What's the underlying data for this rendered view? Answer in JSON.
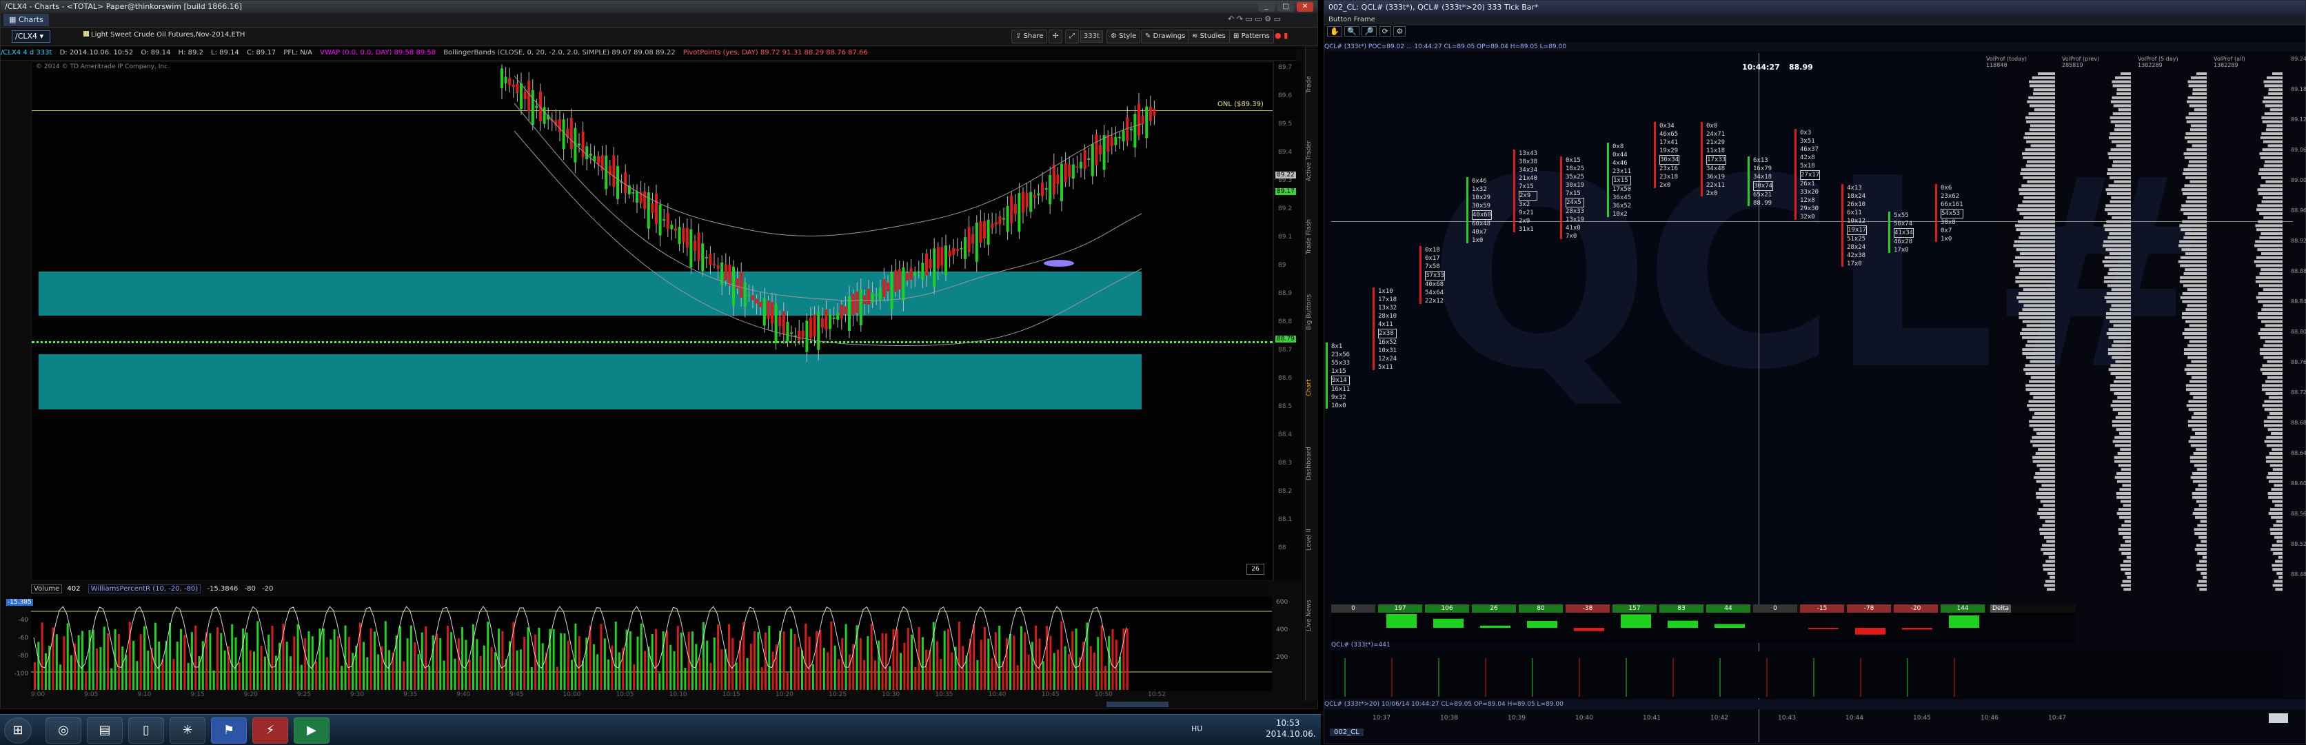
{
  "left_window": {
    "title": "/CLX4 - Charts - <TOTAL> Paper@thinkorswim [build 1866.16]",
    "tab_label": "Charts",
    "symbol": "/CLX4",
    "instrument_name": "Light Sweet Crude Oil Futures,Nov-2014,ETH",
    "toolbar_buttons": [
      "Share",
      "Style",
      "Drawings",
      "Studies",
      "Patterns"
    ],
    "aggregation_badge": "333t",
    "ohlc_stripe": [
      "/CLX4 4 d 333t",
      "D: 2014.10.06. 10:52",
      "O: 89.14",
      "H: 89.2",
      "L: 89.14",
      "C: 89.17",
      "PFL: N/A",
      "VWAP (0.0, 0.0, DAY) 89.58 89.58",
      "BollingerBands (CLOSE, 0, 20, -2.0, 2.0, SIMPLE) 89.07 89.08 89.22",
      "PivotPoints (yes, DAY) 89.72 91.31 88.29 88.76 87.66"
    ],
    "copyright": "© 2014 © TD Ameritrade IP Company, Inc.",
    "onl_label": "ONL ($89.39)",
    "price_ticks": [
      "89.7",
      "89.6",
      "89.5",
      "89.4",
      "89.3",
      "89.2",
      "89.1",
      "89",
      "88.9",
      "88.8",
      "88.7",
      "88.6",
      "88.5",
      "88.4",
      "88.3",
      "88.2",
      "88.1",
      "88"
    ],
    "price_tags": {
      "last": "89.22",
      "bid": "89.17",
      "green": "88.79"
    },
    "corner_badge": "26",
    "indicator": {
      "volume_label": "Volume",
      "volume_value": "402",
      "wr_label": "WilliamsPercentR (10, -20, -80)",
      "wr_value": "-15.3846",
      "wr_hi": "-80",
      "wr_lo": "-20",
      "y_ticks": [
        "-20",
        "-40",
        "-60",
        "-80",
        "-100"
      ],
      "vol_ticks": [
        "600",
        "400",
        "200"
      ],
      "current": "-15.385"
    },
    "time_ticks": [
      "9:00",
      "9:05",
      "9:10",
      "9:15",
      "9:20",
      "9:25",
      "9:30",
      "9:35",
      "9:40",
      "9:45",
      "10:00",
      "10:05",
      "10:10",
      "10:15",
      "10:20",
      "10:25",
      "10:30",
      "10:35",
      "10:40",
      "10:45",
      "10:50",
      "10:52"
    ],
    "side_tabs": [
      "Trade",
      "Active Trader",
      "Trade Flash",
      "Big Buttons",
      "Chart",
      "Dashboard",
      "Level II",
      "Live News"
    ]
  },
  "right_window": {
    "title": "002_CL: QCL# (333t*), QCL# (333t*>20) 333 Tick Bar*",
    "button_frame_label": "Button Frame",
    "info_line": "QCL# (333t*) POC=89.02 ... 10:44:27 CL=89.05 OP=89.04 H=89.05 L=89.00",
    "cursor_time": "10:44:27",
    "cursor_price": "88.99",
    "watermark": "QCL#",
    "footprint_columns": [
      [
        "8x1",
        "23x56",
        "55x33",
        "1x15",
        "9x14",
        "16x11",
        "9x32",
        "10x0"
      ],
      [
        "1x10",
        "17x18",
        "13x32",
        "28x10",
        "4x11",
        "2x38",
        "16x52",
        "10x31",
        "12x24",
        "5x11"
      ],
      [
        "0x18",
        "0x17",
        "7x58",
        "37x33",
        "40x68",
        "54x64",
        "22x12"
      ],
      [
        "0x46",
        "1x32",
        "10x29",
        "30x59",
        "40x60",
        "60x48",
        "40x7",
        "1x0"
      ],
      [
        "13x43",
        "38x38",
        "34x34",
        "21x40",
        "7x15",
        "2x9",
        "3x2",
        "9x21",
        "2x9",
        "31x1"
      ],
      [
        "0x15",
        "18x25",
        "35x25",
        "30x19",
        "7x15",
        "24x5",
        "28x33",
        "13x19",
        "41x0",
        "7x0"
      ],
      [
        "0x8",
        "0x44",
        "4x46",
        "23x11",
        "1x15",
        "17x50",
        "36x45",
        "36x52",
        "10x2"
      ],
      [
        "0x34",
        "46x65",
        "17x41",
        "19x29",
        "30x34",
        "23x16",
        "23x18",
        "2x0"
      ],
      [
        "0x0",
        "24x71",
        "21x29",
        "11x18",
        "17x33",
        "34x48",
        "36x19",
        "22x11",
        "2x0"
      ],
      [
        "6x13",
        "16x79",
        "34x18",
        "30x74",
        "65x21",
        "88.99"
      ],
      [
        "0x3",
        "3x51",
        "46x37",
        "42x8",
        "5x18",
        "27x17",
        "26x1",
        "33x20",
        "12x8",
        "29x30",
        "32x0"
      ],
      [
        "4x13",
        "18x24",
        "26x10",
        "6x11",
        "10x12",
        "19x17",
        "51x25",
        "28x24",
        "42x38",
        "17x0"
      ],
      [
        "5x55",
        "56x74",
        "41x34",
        "46x28",
        "17x0"
      ],
      [
        "0x6",
        "23x62",
        "66x161",
        "54x53",
        "38x8",
        "0x7",
        "1x0"
      ]
    ],
    "volprofile_headers": [
      {
        "label": "VolProf (today)",
        "value": "118848"
      },
      {
        "label": "VolProf (prev)",
        "value": "285819"
      },
      {
        "label": "VolProf (5 day)",
        "value": "1382289"
      },
      {
        "label": "VolProf (all)",
        "value": "1382289"
      }
    ],
    "price_ticks": [
      "89.24",
      "89.18",
      "89.12",
      "89.06",
      "89.00",
      "88.96",
      "88.92",
      "88.88",
      "88.84",
      "88.80",
      "88.76",
      "88.72",
      "88.68",
      "88.64",
      "88.60",
      "88.56",
      "88.52",
      "88.48"
    ],
    "delta_values": [
      "0",
      "197",
      "106",
      "26",
      "80",
      "-38",
      "157",
      "83",
      "44",
      "0",
      "-15",
      "-78",
      "-20",
      "144"
    ],
    "delta_label": "Delta",
    "vol_header": "QCL# (333t*)=441",
    "time_ticks": [
      "10:37",
      "10:38",
      "10:39",
      "10:40",
      "10:41",
      "10:42",
      "10:43",
      "10:44",
      "10:45",
      "10:46",
      "10:47"
    ],
    "footer": "QCL# (333t*>20) 10/06/14 10:44:27 CL=89.05 OP=89.04 H=89.05 L=89.00",
    "tab": "002_CL"
  },
  "taskbar": {
    "start_icon": "windows-start",
    "apps": [
      "chrome",
      "explorer",
      "notepad",
      "green-app",
      "blue-app",
      "red-app",
      "green-flag-app"
    ],
    "language": "HU",
    "time": "10:53",
    "date": "2014.10.06."
  }
}
